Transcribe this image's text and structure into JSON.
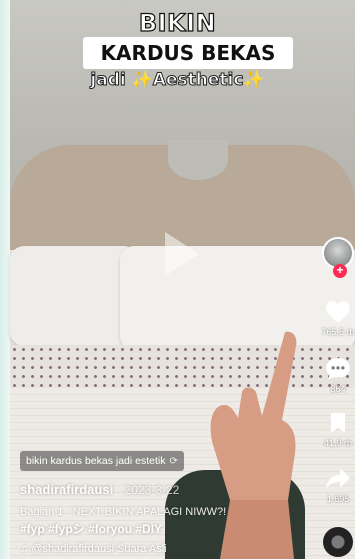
{
  "overlay_text": {
    "line1": "BIKIN",
    "line2": "KARDUS BEKAS",
    "line3": "jadi ✨Aesthetic✨"
  },
  "actions": {
    "likes": "765,5 rb",
    "comments": "864",
    "saves": "41,9 rb",
    "shares": "1.695"
  },
  "video": {
    "caption_pill": "bikin kardus bekas jadi estetik",
    "author": "shadirafirdausi",
    "date": "· 2023-3-22",
    "description": "Bagian 1 : NEXT BIKIN APALAGI NIWW?!",
    "hashtags": "#fyp #fypシ #foryou #DIY",
    "sound": "♫ @shadirafirdausi Suara Asli"
  },
  "colors": {
    "follow": "#fe2c55",
    "headboard": "#b9a998"
  },
  "icons": [
    "play-icon",
    "avatar",
    "follow-plus-icon",
    "heart-icon",
    "comment-icon",
    "bookmark-icon",
    "share-icon",
    "music-disc-icon",
    "repost-icon"
  ]
}
